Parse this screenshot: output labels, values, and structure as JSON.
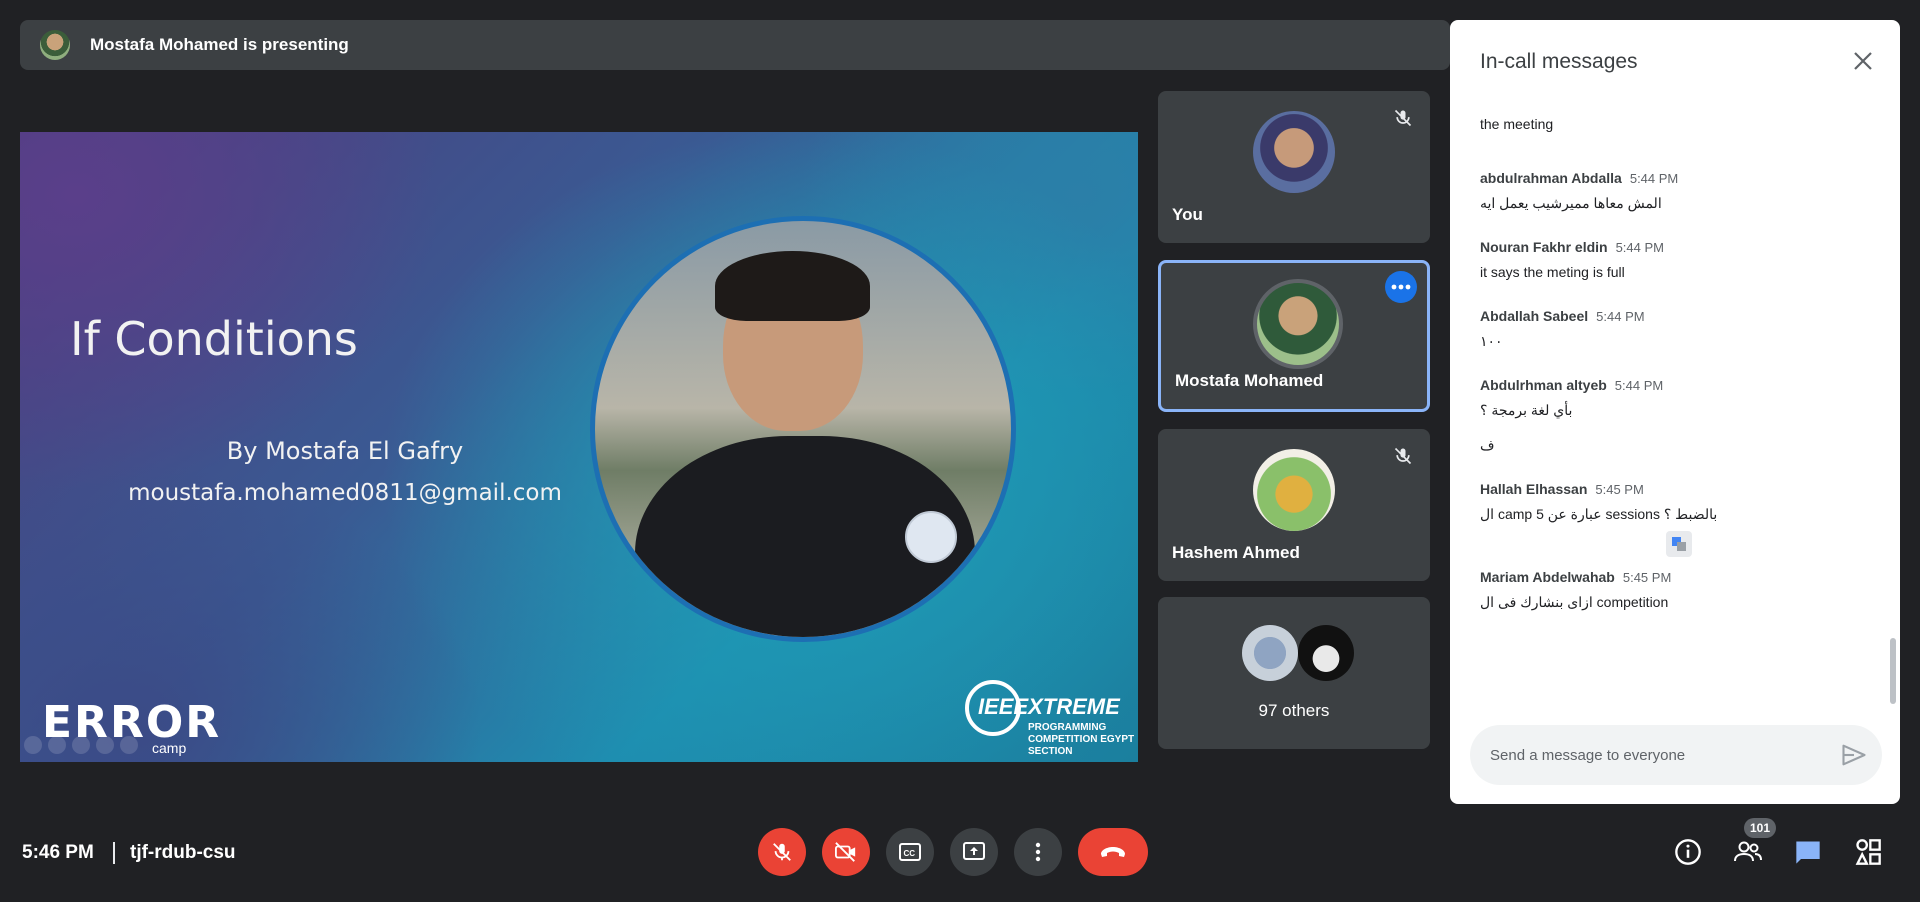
{
  "presenting": {
    "text": "Mostafa Mohamed is presenting",
    "avatar_icon": "avatar-image"
  },
  "slide": {
    "title": "If Conditions",
    "author": "By Mostafa El Gafry",
    "email": "moustafa.mohamed0811@gmail.com",
    "logo_left": "ERROR",
    "logo_left_sub": "camp",
    "logo_right": "IEEEXTREME",
    "logo_right_sub": "PROGRAMMING COMPETITION EGYPT SECTION"
  },
  "tiles": [
    {
      "name": "You",
      "muted": true
    },
    {
      "name": "Mostafa Mohamed",
      "active": true,
      "muted": false
    },
    {
      "name": "Hashem Ahmed",
      "muted": true
    },
    {
      "name": "97 others"
    }
  ],
  "chat": {
    "title": "In-call messages",
    "previous_line": "the meeting",
    "messages": [
      {
        "sender": "abdulrahman Abdalla",
        "time": "5:44 PM",
        "text": "المش معاها مميرشيب يعمل ايه"
      },
      {
        "sender": "Nouran Fakhr eldin",
        "time": "5:44 PM",
        "text": "it says the meting is full"
      },
      {
        "sender": "Abdallah Sabeel",
        "time": "5:44 PM",
        "text": "١٠٠"
      },
      {
        "sender": "Abdulrhman altyeb",
        "time": "5:44 PM",
        "text": "بأي لغة برمجة ؟",
        "extra": "ف"
      },
      {
        "sender": "Hallah Elhassan",
        "time": "5:45 PM",
        "text": "ال camp عبارة عن 5 sessions بالضبط ؟"
      },
      {
        "sender": "Mariam Abdelwahab",
        "time": "5:45 PM",
        "text": "ازاى بنشارك فى ال competition"
      }
    ],
    "input_placeholder": "Send a message to everyone"
  },
  "bottom": {
    "clock": "5:46 PM",
    "meeting_code": "tjf-rdub-csu",
    "participants_count": "101"
  },
  "colors": {
    "accent": "#1a73e8",
    "danger": "#ea4335",
    "bg": "#202124",
    "tile": "#3c4043"
  }
}
